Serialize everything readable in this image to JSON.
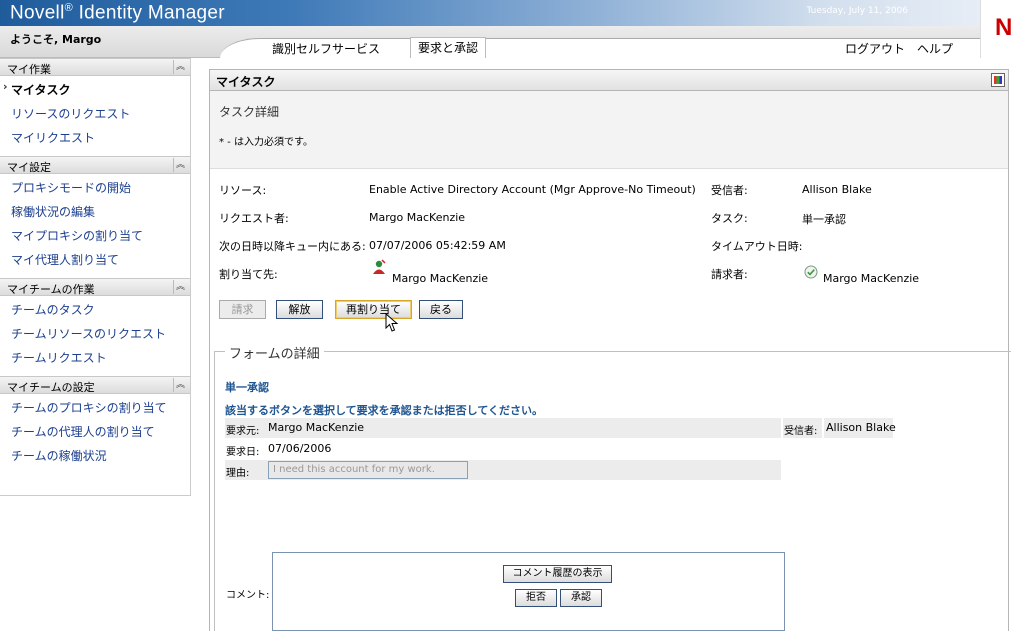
{
  "header": {
    "brand": "Novell",
    "brand_mark": "®",
    "product": " Identity Manager",
    "date": "Tuesday, July 11, 2006",
    "logo_letter": "N",
    "welcome": "ようこそ, Margo",
    "tabs": [
      {
        "label": "識別セルフサービス"
      },
      {
        "label": "要求と承認"
      }
    ],
    "logout": "ログアウト",
    "help": "ヘルプ"
  },
  "sidebar": {
    "sections": [
      {
        "title": "マイ作業",
        "items": [
          "マイタスク",
          "リソースのリクエスト",
          "マイリクエスト"
        ]
      },
      {
        "title": "マイ設定",
        "items": [
          "プロキシモードの開始",
          "稼働状況の編集",
          "マイプロキシの割り当て",
          "マイ代理人割り当て"
        ]
      },
      {
        "title": "マイチームの作業",
        "items": [
          "チームのタスク",
          "チームリソースのリクエスト",
          "チームリクエスト"
        ]
      },
      {
        "title": "マイチームの設定",
        "items": [
          "チームのプロキシの割り当て",
          "チームの代理人の割り当て",
          "チームの稼働状況"
        ]
      }
    ],
    "collapse_icon": "double-chevron-up-icon"
  },
  "main": {
    "title": "マイタスク",
    "subtitle": "タスク詳細",
    "required_note": "* - は入力必須です。",
    "details": {
      "resource_label": "リソース:",
      "resource_value": "Enable Active Directory Account (Mgr Approve-No Timeout)",
      "recipient_label": "受信者:",
      "recipient_value": "Allison Blake",
      "requester_label": "リクエスト者:",
      "requester_value": "Margo MacKenzie",
      "task_label": "タスク:",
      "task_value": "単一承認",
      "queued_label": "次の日時以降キュー内にある:",
      "queued_value": "07/07/2006 05:42:59 AM",
      "timeout_label": "タイムアウト日時:",
      "assigned_label": "割り当て先:",
      "assigned_value": "Margo MacKenzie",
      "claimant_label": "請求者:",
      "claimant_value": "Margo MacKenzie"
    },
    "buttons": {
      "claim": "請求",
      "release": "解放",
      "reassign": "再割り当て",
      "back": "戻る"
    }
  },
  "form": {
    "legend": "フォームの詳細",
    "heading": "単一承認",
    "instruction": "該当するボタンを選択して要求を承認または拒否してください。",
    "request_from_label": "要求元:",
    "request_from_value": "Margo MacKenzie",
    "recipient_label": "受信者:",
    "recipient_value": "Allison Blake",
    "request_date_label": "要求日:",
    "request_date_value": "07/06/2006",
    "reason_label": "理由:",
    "reason_value": "I need this account for my work.",
    "comment_label": "コメント:",
    "comment_value": "",
    "show_history": "コメント履歴の表示",
    "deny": "拒否",
    "approve": "承認"
  }
}
